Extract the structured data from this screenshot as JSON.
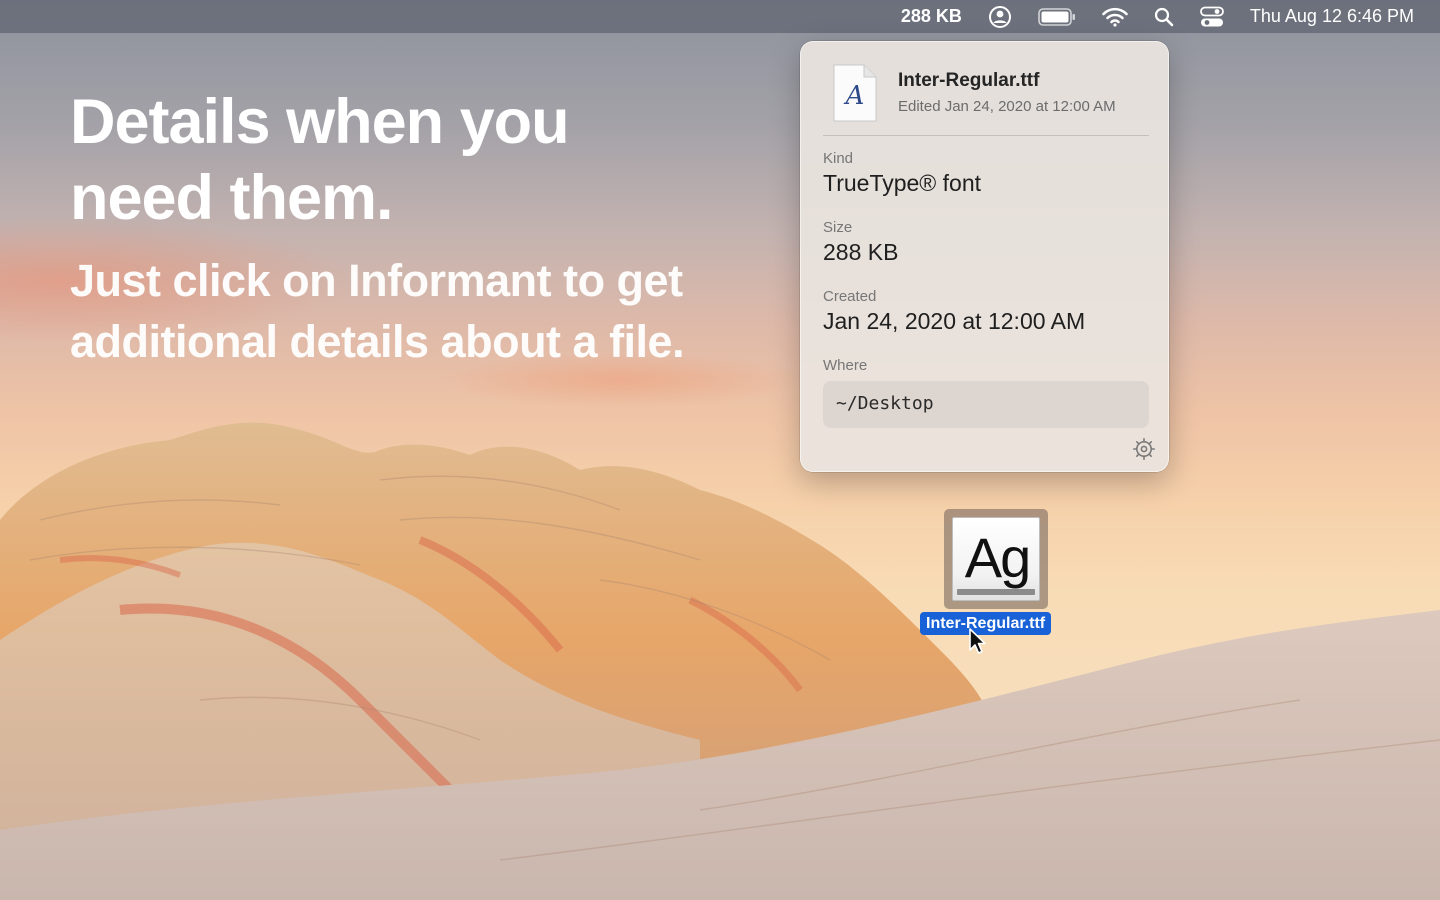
{
  "menubar": {
    "size_label": "288 KB",
    "clock": "Thu Aug 12  6:46 PM",
    "icons": [
      "informant-icon",
      "battery-icon",
      "wifi-icon",
      "spotlight-search-icon",
      "control-center-icon"
    ]
  },
  "marketing": {
    "headline_line1": "Details when you",
    "headline_line2": "need them.",
    "subheadline_line1": "Just click on Informant to get",
    "subheadline_line2": "additional details about a file."
  },
  "popover": {
    "file_name": "Inter-Regular.ttf",
    "edited": "Edited Jan 24, 2020 at 12:00 AM",
    "fields": [
      {
        "label": "Kind",
        "value": "TrueType® font"
      },
      {
        "label": "Size",
        "value": "288 KB"
      },
      {
        "label": "Created",
        "value": "Jan 24, 2020 at 12:00 AM"
      }
    ],
    "where_label": "Where",
    "where_path": "~/Desktop",
    "icons": [
      "font-file-icon",
      "settings-gear-icon"
    ]
  },
  "desktop": {
    "file_glyph": "Ag",
    "file_label": "Inter-Regular.ttf"
  },
  "colors": {
    "selection_blue": "#1861d6",
    "menubar_bg": "#696e7a"
  }
}
